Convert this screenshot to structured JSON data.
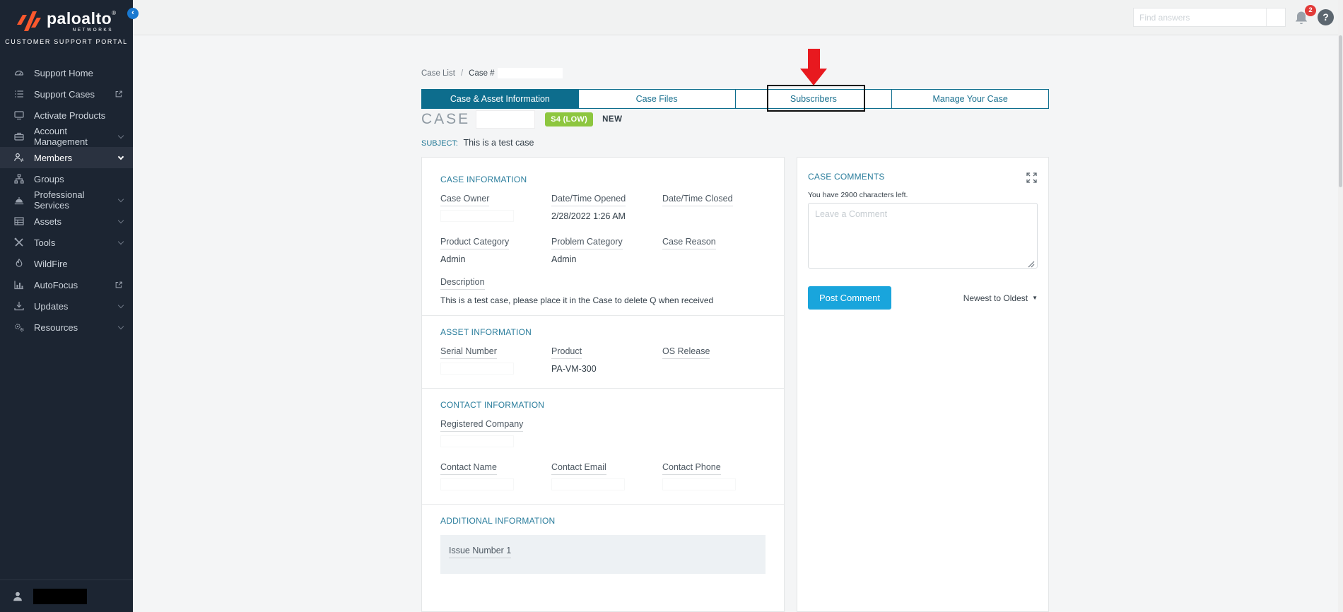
{
  "colors": {
    "sidebar_bg": "#1c2532",
    "accent_teal": "#0d6d8d",
    "brand_orange": "#fa582d",
    "badge_green": "#8dc63f",
    "button_blue": "#19a5dc",
    "annotation_red": "#e8191f",
    "notification_red": "#e23a38"
  },
  "brand": {
    "logo": "paloalto",
    "reg": "®",
    "sub": "NETWORKS",
    "portal": "CUSTOMER SUPPORT PORTAL"
  },
  "header": {
    "search_placeholder": "Find answers",
    "notification_count": "2",
    "help_glyph": "?"
  },
  "icons": {
    "collapse": "‹",
    "sort_caret": "▼"
  },
  "sidebar": {
    "items": [
      {
        "label": "Support Home"
      },
      {
        "label": "Support Cases",
        "external": true
      },
      {
        "label": "Activate Products"
      },
      {
        "label": "Account Management",
        "chevron": true
      },
      {
        "label": "Members",
        "chevron": true,
        "active": true
      },
      {
        "label": "Groups"
      },
      {
        "label": "Professional Services",
        "chevron": true
      },
      {
        "label": "Assets",
        "chevron": true
      },
      {
        "label": "Tools",
        "chevron": true
      },
      {
        "label": "WildFire"
      },
      {
        "label": "AutoFocus",
        "external": true
      },
      {
        "label": "Updates",
        "chevron": true
      },
      {
        "label": "Resources",
        "chevron": true
      }
    ]
  },
  "breadcrumb": {
    "parent": "Case List",
    "separator": "/",
    "current": "Case #"
  },
  "tabs": {
    "items": [
      {
        "label": "Case & Asset Information",
        "active": true
      },
      {
        "label": "Case Files"
      },
      {
        "label": "Subscribers",
        "annotated": true
      },
      {
        "label": "Manage Your Case"
      }
    ]
  },
  "case_header": {
    "title": "CASE",
    "severity": "S4 (LOW)",
    "status": "NEW",
    "subject_label": "SUBJECT:",
    "subject": "This is a test case"
  },
  "case_info": {
    "heading": "CASE INFORMATION",
    "case_owner_label": "Case Owner",
    "date_opened_label": "Date/Time Opened",
    "date_opened_value": "2/28/2022 1:26 AM",
    "date_closed_label": "Date/Time Closed",
    "product_category_label": "Product Category",
    "product_category_value": "Admin",
    "problem_category_label": "Problem Category",
    "problem_category_value": "Admin",
    "case_reason_label": "Case Reason",
    "description_label": "Description",
    "description_value": "This is a test case, please place it in the Case to delete Q when received"
  },
  "asset_info": {
    "heading": "ASSET INFORMATION",
    "serial_label": "Serial Number",
    "product_label": "Product",
    "product_value": "PA-VM-300",
    "os_label": "OS Release"
  },
  "contact_info": {
    "heading": "CONTACT INFORMATION",
    "company_label": "Registered Company",
    "name_label": "Contact Name",
    "email_label": "Contact Email",
    "phone_label": "Contact Phone"
  },
  "additional_info": {
    "heading": "ADDITIONAL INFORMATION",
    "issue_label": "Issue Number 1"
  },
  "case_comments": {
    "heading": "CASE COMMENTS",
    "chars_left": "You have 2900 characters left.",
    "placeholder": "Leave a Comment",
    "post_button": "Post Comment",
    "sort_label": "Newest to Oldest"
  }
}
